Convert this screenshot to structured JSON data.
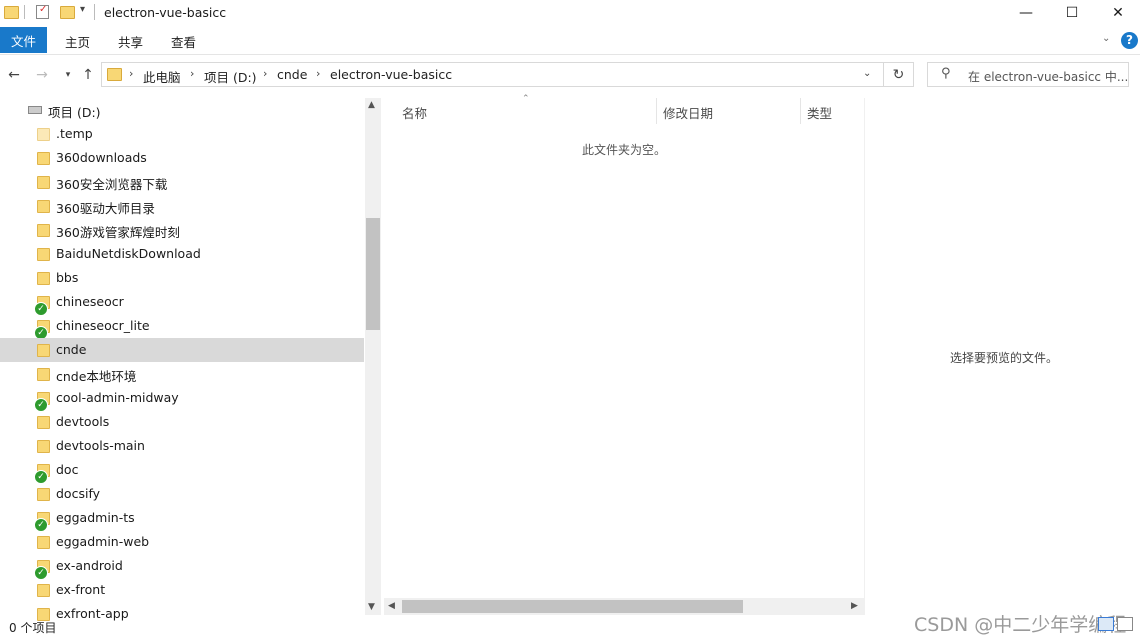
{
  "window": {
    "title": "electron-vue-basicc",
    "minimize_glyph": "—",
    "maximize_glyph": "☐",
    "close_glyph": "✕"
  },
  "ribbon": {
    "file_tab": "文件",
    "tabs": [
      "主页",
      "共享",
      "查看"
    ],
    "help_glyph": "?"
  },
  "address": {
    "crumbs": [
      "此电脑",
      "项目 (D:)",
      "cnde",
      "electron-vue-basicc"
    ],
    "search_placeholder": "在 electron-vue-basicc 中..."
  },
  "tree": {
    "drive_label": "项目 (D:)",
    "items": [
      {
        "label": ".temp",
        "synced": false,
        "pale": true,
        "selected": false
      },
      {
        "label": "360downloads",
        "synced": false,
        "pale": false,
        "selected": false
      },
      {
        "label": "360安全浏览器下载",
        "synced": false,
        "pale": false,
        "selected": false
      },
      {
        "label": "360驱动大师目录",
        "synced": false,
        "pale": false,
        "selected": false
      },
      {
        "label": "360游戏管家辉煌时刻",
        "synced": false,
        "pale": false,
        "selected": false
      },
      {
        "label": "BaiduNetdiskDownload",
        "synced": false,
        "pale": false,
        "selected": false
      },
      {
        "label": "bbs",
        "synced": false,
        "pale": false,
        "selected": false
      },
      {
        "label": "chineseocr",
        "synced": true,
        "pale": false,
        "selected": false
      },
      {
        "label": "chineseocr_lite",
        "synced": true,
        "pale": false,
        "selected": false
      },
      {
        "label": "cnde",
        "synced": false,
        "pale": false,
        "selected": true
      },
      {
        "label": "cnde本地环境",
        "synced": false,
        "pale": false,
        "selected": false
      },
      {
        "label": "cool-admin-midway",
        "synced": true,
        "pale": false,
        "selected": false
      },
      {
        "label": "devtools",
        "synced": false,
        "pale": false,
        "selected": false
      },
      {
        "label": "devtools-main",
        "synced": false,
        "pale": false,
        "selected": false
      },
      {
        "label": "doc",
        "synced": true,
        "pale": false,
        "selected": false
      },
      {
        "label": "docsify",
        "synced": false,
        "pale": false,
        "selected": false
      },
      {
        "label": "eggadmin-ts",
        "synced": true,
        "pale": false,
        "selected": false
      },
      {
        "label": "eggadmin-web",
        "synced": false,
        "pale": false,
        "selected": false
      },
      {
        "label": "ex-android",
        "synced": true,
        "pale": false,
        "selected": false
      },
      {
        "label": "ex-front",
        "synced": false,
        "pale": false,
        "selected": false
      },
      {
        "label": "exfront-app",
        "synced": false,
        "pale": false,
        "selected": false
      }
    ]
  },
  "content": {
    "columns": [
      "名称",
      "修改日期",
      "类型"
    ],
    "empty_message": "此文件夹为空。",
    "preview_message": "选择要预览的文件。"
  },
  "status": {
    "item_count": "0 个项目"
  },
  "watermark": "CSDN @中二少年学编程"
}
